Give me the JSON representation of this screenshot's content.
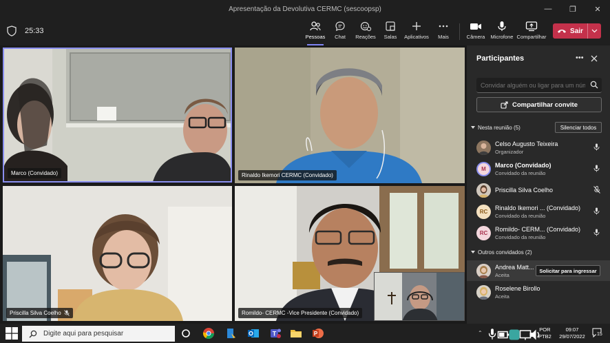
{
  "window": {
    "title": "Apresentação da Devolutiva CERMC (sescoopsp)",
    "controls": [
      "—",
      "❐",
      "✕"
    ]
  },
  "toolbar": {
    "timer": "25:33",
    "tools": [
      {
        "id": "pessoas",
        "label": "Pessoas",
        "icon": "people-icon",
        "active": true
      },
      {
        "id": "chat",
        "label": "Chat",
        "icon": "chat-icon"
      },
      {
        "id": "reacoes",
        "label": "Reações",
        "icon": "reactions-icon"
      },
      {
        "id": "salas",
        "label": "Salas",
        "icon": "rooms-icon"
      },
      {
        "id": "aplicativos",
        "label": "Aplicativos",
        "icon": "plus-icon"
      },
      {
        "id": "mais",
        "label": "Mais",
        "icon": "more-icon"
      },
      {
        "id": "camera",
        "label": "Câmera",
        "icon": "camera-icon"
      },
      {
        "id": "microfone",
        "label": "Microfone",
        "icon": "microphone-icon"
      },
      {
        "id": "compartilhar",
        "label": "Compartilhar",
        "icon": "share-icon"
      }
    ],
    "leave_label": "Sair"
  },
  "video": {
    "tiles": [
      {
        "label": "Marco (Convidado)",
        "muted": false,
        "active": true
      },
      {
        "label": "Rinaldo Ikemori CERMC (Convidado)",
        "muted": false,
        "active": false
      },
      {
        "label": "Priscilla Silva Coelho",
        "muted": true,
        "active": false
      },
      {
        "label": "Romildo- CERMC -Vice Presidente (Convidado)",
        "muted": false,
        "active": false
      }
    ]
  },
  "panel": {
    "title": "Participantes",
    "search_placeholder": "Convidar alguém ou ligar para um número",
    "share_label": "Compartilhar convite",
    "in_meeting_label": "Nesta reunião (5)",
    "mute_all_label": "Silenciar todos",
    "others_label": "Outros convidados (2)",
    "participants": [
      {
        "name": "Celso Augusto Teixeira",
        "sub": "Organizador",
        "initials": "",
        "bold": false,
        "mic": "on"
      },
      {
        "name": "Marco (Convidado)",
        "sub": "Convidado da reunião",
        "initials": "M",
        "bold": true,
        "mic": "on"
      },
      {
        "name": "Priscilla Silva Coelho",
        "sub": "",
        "initials": "",
        "bold": false,
        "mic": "off"
      },
      {
        "name": "Rinaldo Ikemori ... (Convidado)",
        "sub": "Convidado da reunião",
        "initials": "RC",
        "bold": false,
        "mic": "on"
      },
      {
        "name": "Romildo- CERM... (Convidado)",
        "sub": "Convidado da reunião",
        "initials": "RC",
        "bold": false,
        "mic": "on"
      }
    ],
    "others": [
      {
        "name": "Andrea Matt...",
        "sub": "Aceita",
        "action": "Solicitar para ingressar"
      },
      {
        "name": "Roselene Birollo",
        "sub": "Aceita",
        "action": ""
      }
    ]
  },
  "taskbar": {
    "search_placeholder": "Digite aqui para pesquisar",
    "lang_line1": "POR",
    "lang_line2": "PTB2",
    "time": "09:07",
    "date": "29/07/2022",
    "notifications": "15"
  }
}
